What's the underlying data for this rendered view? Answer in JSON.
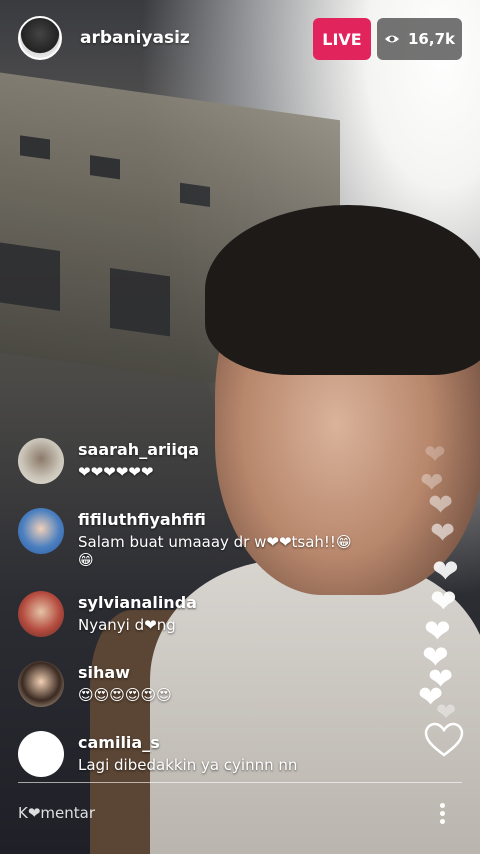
{
  "header": {
    "username": "arbaniyasiz",
    "live_label": "LIVE",
    "viewer_count": "16,7k",
    "viewer_icon": "eye-icon"
  },
  "comments": [
    {
      "user": "saarah_ariiqa",
      "text": "❤❤❤❤❤❤",
      "avatar_color": "#c9c2b6"
    },
    {
      "user": "fifiluthfiyahfifi",
      "text": "Salam buat umaaay dr w❤❤tsah!!😁\n😁",
      "avatar_color": "#6a9fd6"
    },
    {
      "user": "sylvianalinda",
      "text": "Nyanyi d❤ng",
      "avatar_color": "#b54b3f"
    },
    {
      "user": "sihaw",
      "text": "😍😍😍😍😍😍",
      "avatar_color": "#d9a17a"
    },
    {
      "user": "camilia_s",
      "text": "Lagi dibedakkin ya cyinnn nn",
      "avatar_color": "#ffffff"
    }
  ],
  "footer": {
    "comment_placeholder": "K❤mentar",
    "more_icon": "more-vertical-icon",
    "like_icon": "heart-outline-icon"
  }
}
